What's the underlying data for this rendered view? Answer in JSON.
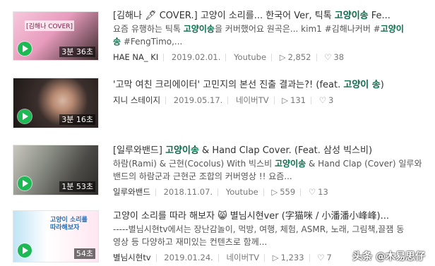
{
  "results": [
    {
      "thumb_text": "[김해나 COVER]",
      "duration": "3분 36초",
      "title_prefix": "[김해나 🖋 COVER.] 고양이 소리를... 한국어 Ver, 틱톡 ",
      "title_bold": "고양이송",
      "title_suffix": " Fe...",
      "desc1_a": "요즘 유행하는 틱톡 ",
      "desc1_b": "고양이송",
      "desc1_c": "을 커버했어요 원곡은... kim1 #김해나커버 #",
      "desc1_d": "고양이",
      "desc2_a": "송",
      "desc2_b": " #FengTimo,...",
      "source": "HAE NA_ KI",
      "date": "2019.02.01.",
      "platform": "Youtube",
      "views": "2,852",
      "likes": "38"
    },
    {
      "duration": "3분 16초",
      "title_prefix": "'고막 여친 크리에이터' 고민지의 본선 진출 결과는?! (feat. ",
      "title_bold": "고양이 송",
      "title_suffix": ")",
      "source": "지니 스테이지",
      "date": "2019.05.17.",
      "platform": "네이버TV",
      "views": "131",
      "likes": "3"
    },
    {
      "duration": "1분 53초",
      "title_prefix": "[일루와밴드] ",
      "title_bold": "고양이송",
      "title_suffix": " & Hand Clap Cover. (Feat. 삼성 빅스비)",
      "desc1_a": "하람(Rami) & 근현(Cocolus) With 빅스비 ",
      "desc1_b": "고양이송",
      "desc1_c": " & Hand Clap (Cover) 일루와",
      "desc2_a": "밴드의 하람군과 근현군 조합의 커버영상 !! 요즘...",
      "source": "일루와밴드",
      "date": "2018.11.07.",
      "platform": "Youtube",
      "views": "559",
      "likes": "13"
    },
    {
      "thumb_text": "고양이 소리를 따라해보자",
      "duration": "54초",
      "title_prefix": "고양이 소리를 따라 해보자 😸 별님시현ver (字猫咪 / 小潘潘小峰峰)...",
      "desc1_a": "-----별님시현tv에서는 장난감놀이, 먹방, 여행, 체험, ASMR, 노래, 그림책,끌잼 동",
      "desc2_a": "영상 등 다양하고 재미있는 컨텐츠로 함께...",
      "source": "별님시현tv",
      "date": "2019.01.24.",
      "platform": "네이버TV",
      "views": "1,233",
      "likes": "7"
    }
  ],
  "watermark": "头条 @木易思仔"
}
